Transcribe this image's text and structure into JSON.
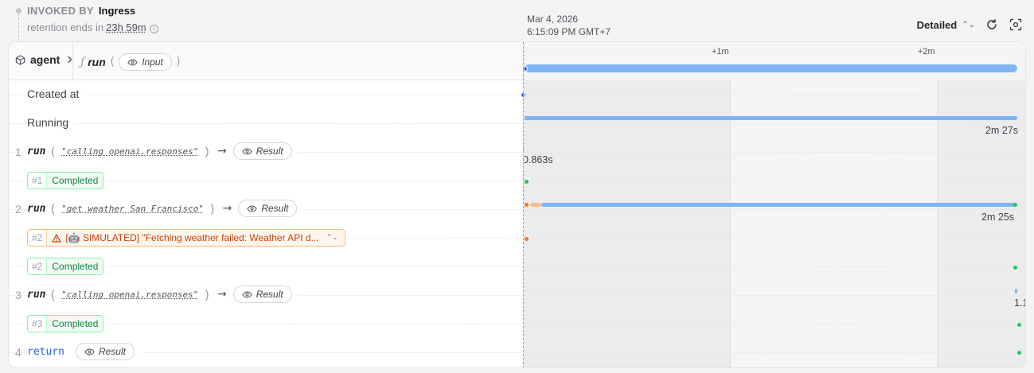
{
  "invoked": {
    "label": "INVOKED BY",
    "value": "Ingress"
  },
  "retention": {
    "label": "retention ends in",
    "value": "23h 59m"
  },
  "timestamp": {
    "date": "Mar 4, 2026",
    "time": "6:15:09 PM GMT+7"
  },
  "toolbar": {
    "view_mode": "Detailed",
    "icons": [
      "chevron-updown-icon",
      "refresh-icon",
      "focus-icon"
    ]
  },
  "header": {
    "service": "agent",
    "handler": "run",
    "input_label": "Input",
    "ticks": [
      "+1m",
      "+2m"
    ]
  },
  "rows": {
    "created_at": "Created at",
    "running": "Running",
    "running_duration": "2m 27s"
  },
  "steps": [
    {
      "num": "1",
      "kw": "run",
      "arg": "\"calling openai.responses\"",
      "result_label": "Result",
      "duration": "0.863s",
      "attempt": "#1",
      "status": "Completed"
    },
    {
      "num": "2",
      "kw": "run",
      "arg": "\"get weather San Francisco\"",
      "result_label": "Result",
      "duration": "2m 25s",
      "error_attempt": "#2",
      "error_text": "[🤖 SIMULATED] \"Fetching weather failed: Weather API d...",
      "attempt": "#2",
      "status": "Completed"
    },
    {
      "num": "3",
      "kw": "run",
      "arg": "\"calling openai.responses\"",
      "result_label": "Result",
      "duration": "1.1",
      "attempt": "#3",
      "status": "Completed"
    },
    {
      "num": "4",
      "kw": "return",
      "result_label": "Result"
    }
  ],
  "colors": {
    "bar": "#7db7f5",
    "ok": "#22c55e",
    "err": "#f97316",
    "accent": "#2563eb"
  }
}
